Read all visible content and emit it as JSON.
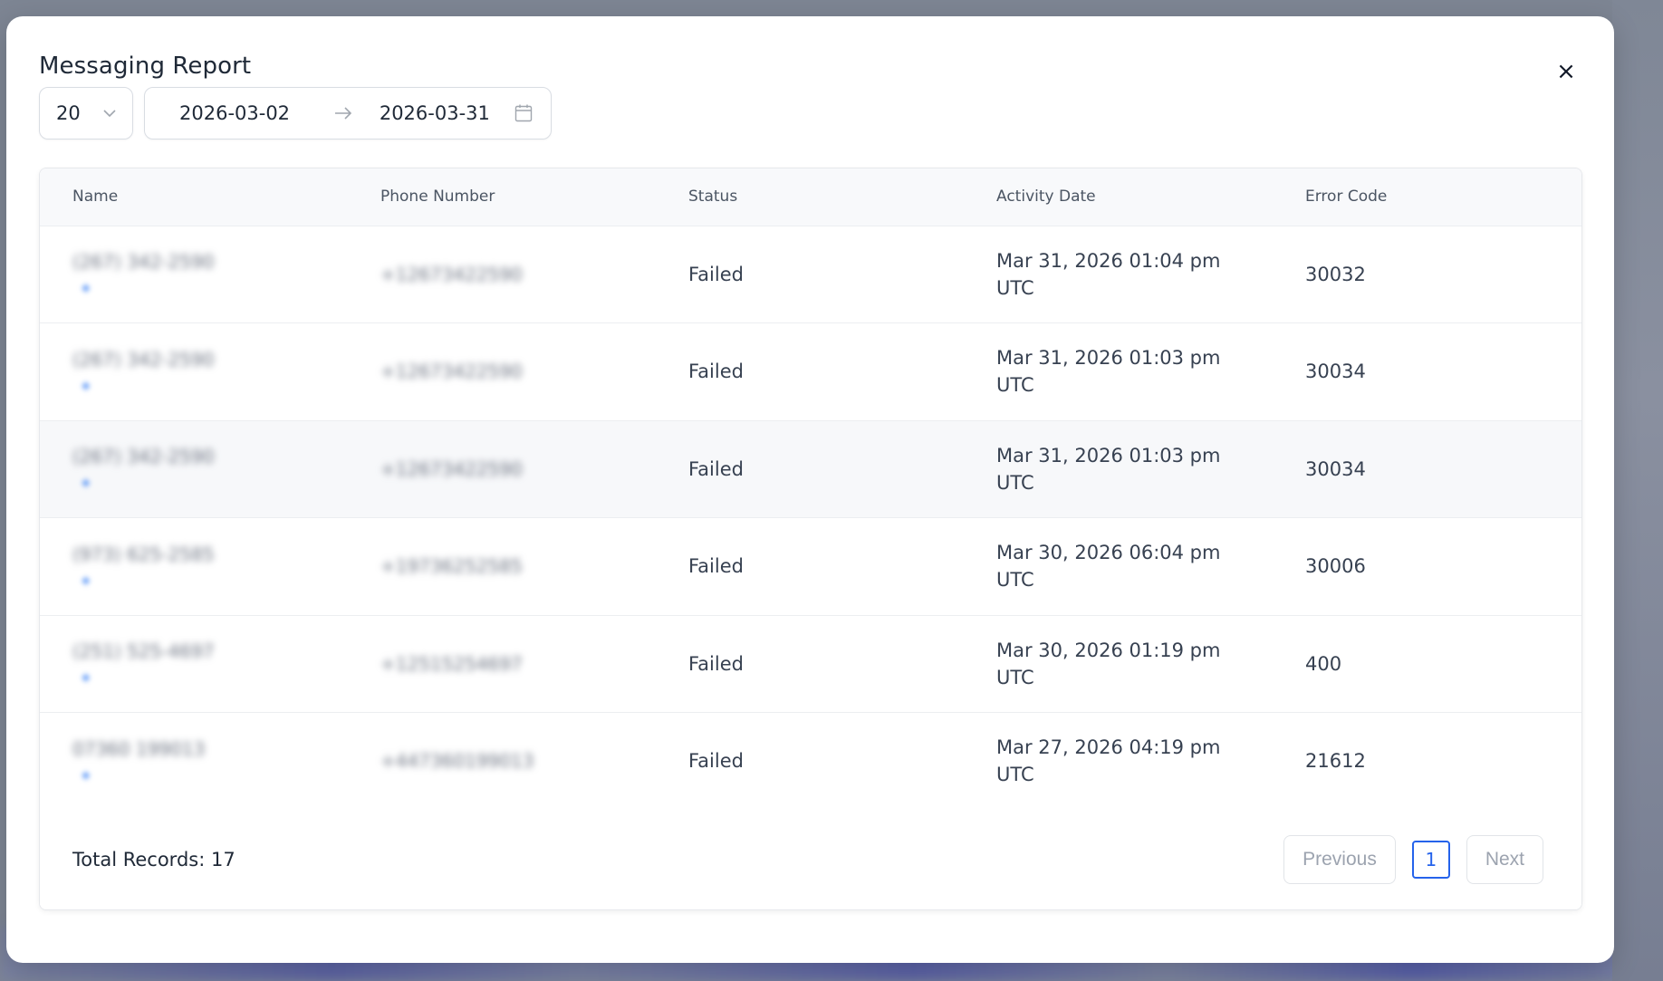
{
  "modal": {
    "title": "Messaging Report",
    "close_glyph": "×"
  },
  "toolbar": {
    "page_size": "20",
    "date_start": "2026-03-02",
    "date_end": "2026-03-31"
  },
  "table": {
    "headers": [
      "Name",
      "Phone Number",
      "Status",
      "Activity Date",
      "Error Code"
    ],
    "rows": [
      {
        "name": "(267) 342-2590",
        "phone": "+12673422590",
        "status": "Failed",
        "date_line1": "Mar 31, 2026 01:04 pm",
        "date_line2": "UTC",
        "error_code": "30032"
      },
      {
        "name": "(267) 342-2590",
        "phone": "+12673422590",
        "status": "Failed",
        "date_line1": "Mar 31, 2026 01:03 pm",
        "date_line2": "UTC",
        "error_code": "30034"
      },
      {
        "name": "(267) 342-2590",
        "phone": "+12673422590",
        "status": "Failed",
        "date_line1": "Mar 31, 2026 01:03 pm",
        "date_line2": "UTC",
        "error_code": "30034"
      },
      {
        "name": "(973) 625-2585",
        "phone": "+19736252585",
        "status": "Failed",
        "date_line1": "Mar 30, 2026 06:04 pm",
        "date_line2": "UTC",
        "error_code": "30006"
      },
      {
        "name": "(251) 525-4697",
        "phone": "+12515254697",
        "status": "Failed",
        "date_line1": "Mar 30, 2026 01:19 pm",
        "date_line2": "UTC",
        "error_code": "400"
      },
      {
        "name": "07360 199013",
        "phone": "+447360199013",
        "status": "Failed",
        "date_line1": "Mar 27, 2026 04:19 pm",
        "date_line2": "UTC",
        "error_code": "21612"
      }
    ]
  },
  "footer": {
    "total_records": "Total Records: 17",
    "previous_label": "Previous",
    "current_page": "1",
    "next_label": "Next"
  },
  "icons": {
    "close": "close-icon",
    "dropdown": "chevron-down-icon",
    "range_arrow": "arrow-right-icon",
    "calendar": "calendar-icon"
  },
  "colors": {
    "accent": "#2563eb",
    "text_primary": "#1f2937",
    "text_muted": "#9ca3af"
  }
}
